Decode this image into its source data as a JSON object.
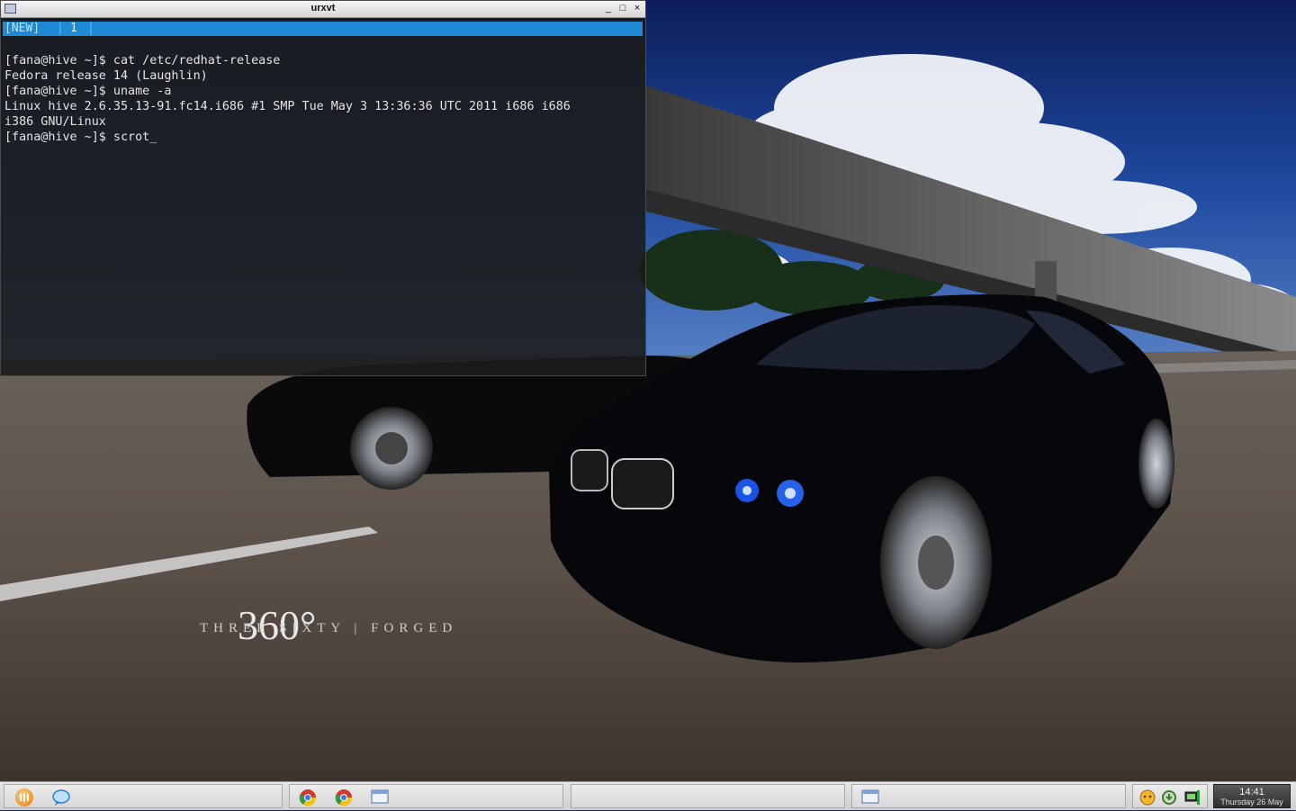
{
  "terminal": {
    "title": "urxvt",
    "controls": {
      "minimize": "_",
      "maximize": "□",
      "close": "×"
    },
    "tabbar": {
      "new_label": "[NEW]",
      "separator": "|",
      "tab_number": "1"
    },
    "lines": [
      "[fana@hive ~]$ cat /etc/redhat-release",
      "Fedora release 14 (Laughlin)",
      "[fana@hive ~]$ uname -a",
      "Linux hive 2.6.35.13-91.fc14.i686 #1 SMP Tue May 3 13:36:36 UTC 2011 i686 i686",
      "i386 GNU/Linux",
      "[fana@hive ~]$ scrot_"
    ]
  },
  "wallpaper": {
    "brand_big": "360°",
    "brand_line": "THREE SIXTY | FORGED"
  },
  "taskbar": {
    "launchers": [
      {
        "icon": "menu-icon",
        "color": "#f0a020"
      },
      {
        "icon": "chat-bubble-icon",
        "color": "#3a8fd8"
      }
    ],
    "tasks": [
      {
        "icon": "chrome-icon"
      },
      {
        "icon": "chrome-icon"
      },
      {
        "icon": "window-icon"
      }
    ],
    "active_window": {
      "icon": "window-icon"
    },
    "tray": [
      {
        "icon": "messenger-tray-icon"
      },
      {
        "icon": "update-tray-icon"
      },
      {
        "icon": "network-tray-icon"
      }
    ],
    "clock": {
      "time": "14:41",
      "date": "Thursday 26 May"
    }
  }
}
